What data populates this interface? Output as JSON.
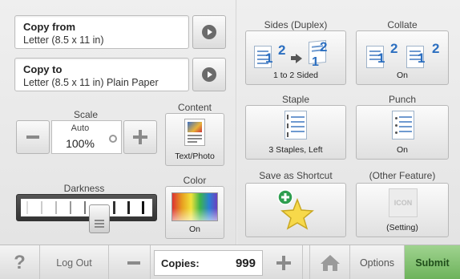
{
  "copy_from": {
    "title": "Copy from",
    "value": "Letter (8.5 x 11 in)"
  },
  "copy_to": {
    "title": "Copy to",
    "value": "Letter (8.5 x 11 in) Plain Paper"
  },
  "scale": {
    "label": "Scale",
    "mode": "Auto",
    "value": "100%"
  },
  "content": {
    "label": "Content",
    "value": "Text/Photo"
  },
  "darkness": {
    "label": "Darkness",
    "level": 5,
    "max": 9
  },
  "color": {
    "label": "Color",
    "value": "On"
  },
  "sides": {
    "label": "Sides (Duplex)",
    "value": "1 to 2 Sided"
  },
  "collate": {
    "label": "Collate",
    "value": "On"
  },
  "staple": {
    "label": "Staple",
    "value": "3 Staples, Left"
  },
  "punch": {
    "label": "Punch",
    "value": "On"
  },
  "shortcut": {
    "label": "Save as Shortcut"
  },
  "other": {
    "label": "(Other Feature)",
    "icon_text": "ICON",
    "value": "(Setting)"
  },
  "bottom": {
    "help": "?",
    "logout": "Log Out",
    "copies_label": "Copies:",
    "copies_value": "999",
    "options": "Options",
    "submit": "Submit"
  },
  "colors": {
    "submit_green": "#7fbf6e",
    "number_blue": "#2c6fc0",
    "star": "#f7d94a",
    "shortcut_plus": "#2e9e4f"
  }
}
